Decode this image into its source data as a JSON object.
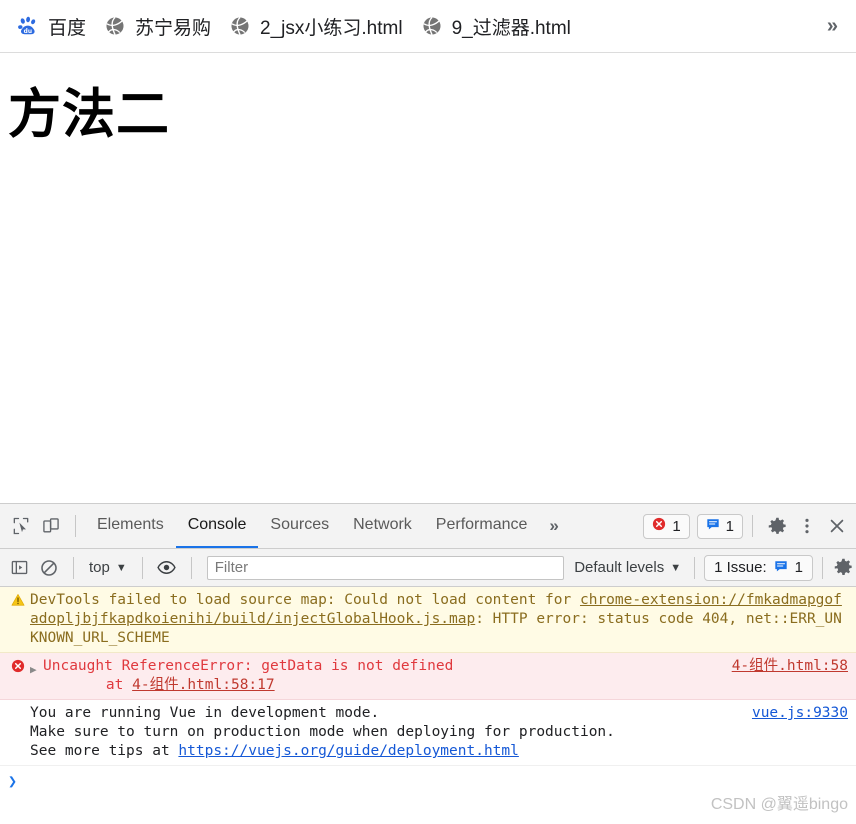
{
  "browser": {
    "bookmarks": [
      {
        "label": "百度",
        "icon": "baidu-paw-icon"
      },
      {
        "label": "苏宁易购",
        "icon": "globe-icon"
      },
      {
        "label": "2_jsx小练习.html",
        "icon": "globe-icon"
      },
      {
        "label": "9_过滤器.html",
        "icon": "globe-icon"
      }
    ],
    "overflow_label": "»"
  },
  "page": {
    "heading": "方法二"
  },
  "devtools": {
    "toolbar": {
      "inspect_icon": "inspect-element-icon",
      "device_icon": "device-toolbar-icon",
      "tabs": [
        {
          "label": "Elements",
          "active": false
        },
        {
          "label": "Console",
          "active": true
        },
        {
          "label": "Sources",
          "active": false
        },
        {
          "label": "Network",
          "active": false
        },
        {
          "label": "Performance",
          "active": false
        }
      ],
      "tabs_more_label": "»",
      "error_count": "1",
      "message_count": "1",
      "settings_icon": "gear-icon",
      "more_icon": "kebab-menu-icon",
      "close_icon": "close-icon"
    },
    "console_toolbar": {
      "sidebar_toggle_icon": "console-sidebar-icon",
      "clear_icon": "clear-console-icon",
      "context_label": "top",
      "context_caret": "▼",
      "eye_icon": "live-expression-icon",
      "filter_placeholder": "Filter",
      "filter_value": "",
      "levels_label": "Default levels",
      "levels_caret": "▼",
      "issues_label": "1 Issue:",
      "issues_count": "1",
      "settings_icon": "gear-icon"
    },
    "messages": [
      {
        "type": "warning",
        "icon": "warning-triangle-icon",
        "text_parts": [
          {
            "t": "DevTools failed to load source map: Could not load content for ",
            "link": false
          },
          {
            "t": "chrome-extension://fmkadmapgofadopljbjfkapdkoienihi/build/injectGlobalHook.js.map",
            "link": true
          },
          {
            "t": ": HTTP error: status code 404, net::ERR_UNKNOWN_URL_SCHEME",
            "link": false
          }
        ],
        "source": ""
      },
      {
        "type": "error",
        "icon": "error-circle-icon",
        "expander": "▶",
        "text_parts": [
          {
            "t": "Uncaught ReferenceError: getData is not defined",
            "link": false
          }
        ],
        "stack_prefix": "    at ",
        "stack_link": "4-组件.html:58:17",
        "source": "4-组件.html:58"
      },
      {
        "type": "info",
        "icon": "",
        "text_parts": [
          {
            "t": "You are running Vue in development mode.\nMake sure to turn on production mode when deploying for production.\nSee more tips at ",
            "link": false
          },
          {
            "t": "https://vuejs.org/guide/deployment.html",
            "link": true
          }
        ],
        "source": "vue.js:9330"
      }
    ],
    "prompt": {
      "chevron": "❯",
      "value": ""
    }
  },
  "watermark": "CSDN @翼遥bingo",
  "colors": {
    "accent": "#1a73e8",
    "error": "#e0393e",
    "warning": "#8a6d1f",
    "warning_bg": "#fffbe5",
    "error_bg": "#fdecee",
    "link": "#1558d6"
  }
}
